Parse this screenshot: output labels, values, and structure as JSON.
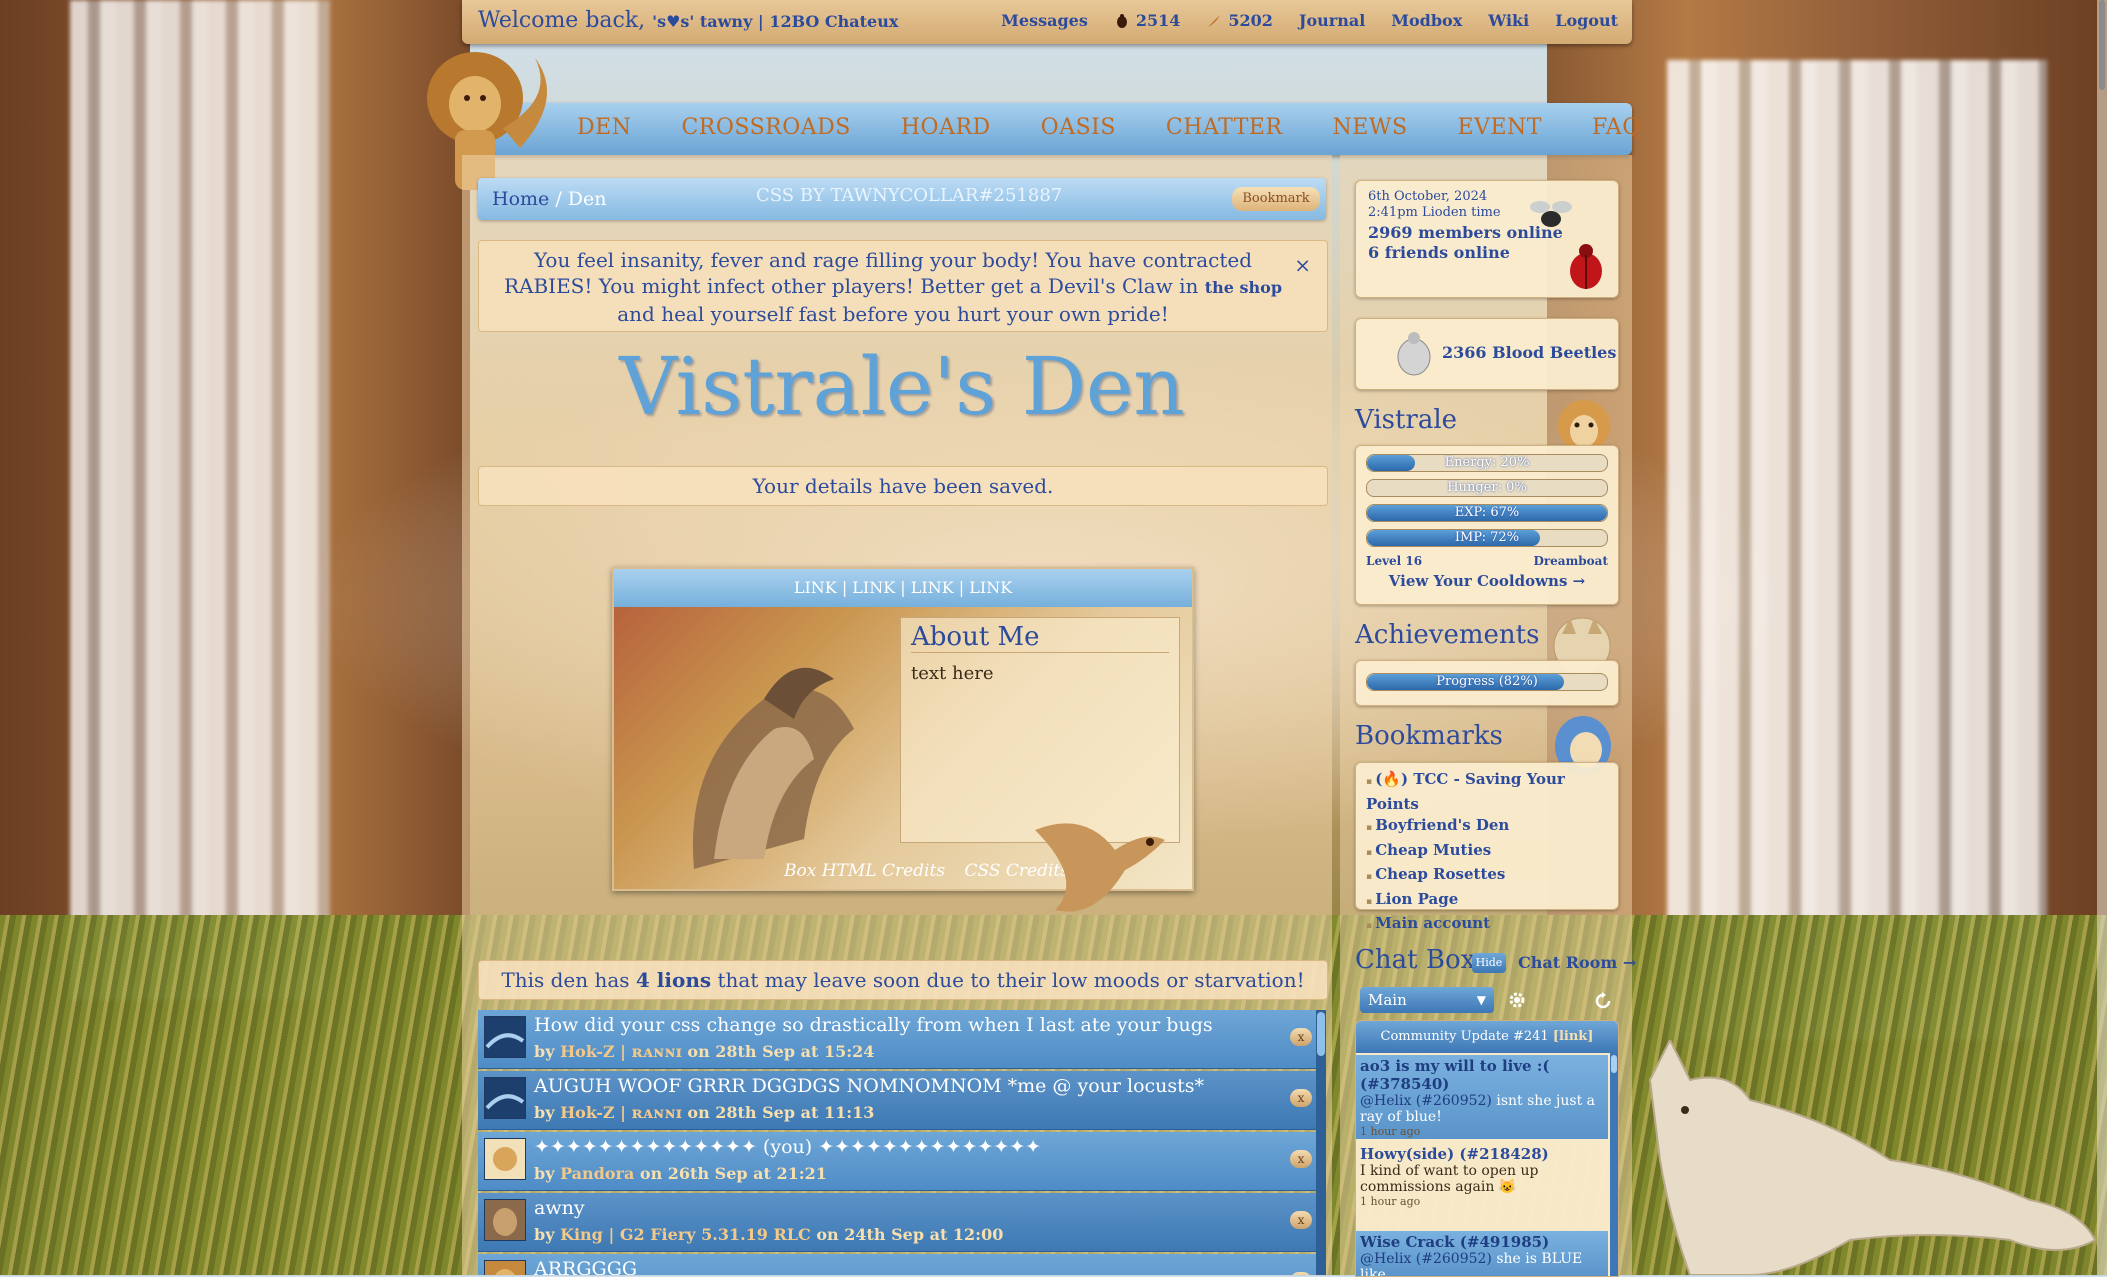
{
  "topbar": {
    "welcome": "Welcome back,",
    "user": "'s♥s' tawny | 12BO Chateux",
    "links": {
      "messages": "Messages",
      "currency1": "2514",
      "currency2": "5202",
      "journal": "Journal",
      "modbox": "Modbox",
      "wiki": "Wiki",
      "logout": "Logout"
    }
  },
  "nav": {
    "items": [
      "DEN",
      "CROSSROADS",
      "HOARD",
      "OASIS",
      "CHATTER",
      "NEWS",
      "EVENT",
      "FAQ"
    ]
  },
  "breadcrumb": {
    "home": "Home",
    "sep": "/",
    "current": "Den",
    "css_credit": "CSS BY TAWNYCOLLAR#251887",
    "bookmark": "Bookmark"
  },
  "notice": {
    "text_before": "You feel insanity, fever and rage filling your body! You have contracted RABIES! You might infect other players! Better get a Devil's Claw in",
    "shop_link": "the shop",
    "text_after": "and heal yourself fast before you hurt your own pride!",
    "close": "×"
  },
  "den": {
    "title": "Vistrale's Den",
    "saved": "Your details have been saved."
  },
  "profile": {
    "links": [
      "LINK",
      "LINK",
      "LINK",
      "LINK"
    ],
    "sep": "|",
    "about_title": "About Me",
    "about_text": "text here",
    "credit1": "Box HTML Credits",
    "credit2": "CSS Credits"
  },
  "moods": {
    "before": "This den has",
    "count": "4 lions",
    "after": "that may leave soon due to their low moods or starvation!"
  },
  "comments": [
    {
      "title": "How did your css change so drastically from when I last ate your bugs",
      "by": "by",
      "user": "Hok-Z | ʀᴀɴɴɪ",
      "when": "on 28th Sep at 15:24",
      "x": "x"
    },
    {
      "title": "AUGUH WOOF GRRR DGGDGS NOMNOMNOM *me @ your locusts*",
      "by": "by",
      "user": "Hok-Z | ʀᴀɴɴɪ",
      "when": "on 28th Sep at 11:13",
      "x": "x"
    },
    {
      "title": "✦✦✦✦✦✦✦✦✦✦✦✦✦✦ (you) ✦✦✦✦✦✦✦✦✦✦✦✦✦✦",
      "by": "by",
      "user": "Pandora",
      "when": "on 26th Sep at 21:21",
      "x": "x"
    },
    {
      "title": "awny",
      "by": "by",
      "user": "King | G2 Fiery 5.31.19 RLC",
      "when": "on 24th Sep at 12:00",
      "x": "x"
    },
    {
      "title": "ARRGGGG",
      "by": "",
      "user": "",
      "when": "",
      "x": "x"
    }
  ],
  "sidebar": {
    "date": "6th October, 2024",
    "time": "2:41pm Lioden time",
    "members_online": "2969 members online",
    "friends_online": "6 friends online",
    "blood_beetles": "2366 Blood Beetles",
    "lion_name": "Vistrale",
    "bars": [
      {
        "label": "Energy: 20%",
        "value": 20
      },
      {
        "label": "Hunger: 0%",
        "value": 0
      },
      {
        "label": "EXP: 67%",
        "value": 100
      },
      {
        "label": "IMP: 72%",
        "value": 72
      }
    ],
    "level": "Level 16",
    "dreamboat": "Dreamboat",
    "cooldowns": "View Your Cooldowns →",
    "achievements_title": "Achievements",
    "achievements_progress": {
      "label": "Progress (82%)",
      "value": 82
    },
    "bookmarks_title": "Bookmarks",
    "bookmarks": [
      "(🔥) TCC - Saving Your Points",
      "Boyfriend's Den",
      "Cheap Muties",
      "Cheap Rosettes",
      "Lion Page",
      "Main account"
    ],
    "chat_title": "Chat Box",
    "hide": "Hide",
    "chat_room": "Chat Room →",
    "room": "Main",
    "update_text": "Community Update #241",
    "update_link": "[link]",
    "messages": [
      {
        "who": "ao3 is my will to live :( (#378540)",
        "mention": "@Helix (#260952)",
        "text": "isnt she just a ray of blue!",
        "ago": "1 hour ago"
      },
      {
        "who": "Howy(side) (#218428)",
        "mention": "",
        "text": "I kind of want to open up commissions again 😺",
        "ago": "1 hour ago"
      },
      {
        "who": "Wise Crack (#491985)",
        "mention": "@Helix (#260952)",
        "text": "she is BLUE like",
        "ago": ""
      }
    ]
  },
  "colors": {
    "accent": "#2c4b9c",
    "nav_text": "#c16a22",
    "bar_blue": "#3b7cc0",
    "panel": "#f6e0bc"
  }
}
